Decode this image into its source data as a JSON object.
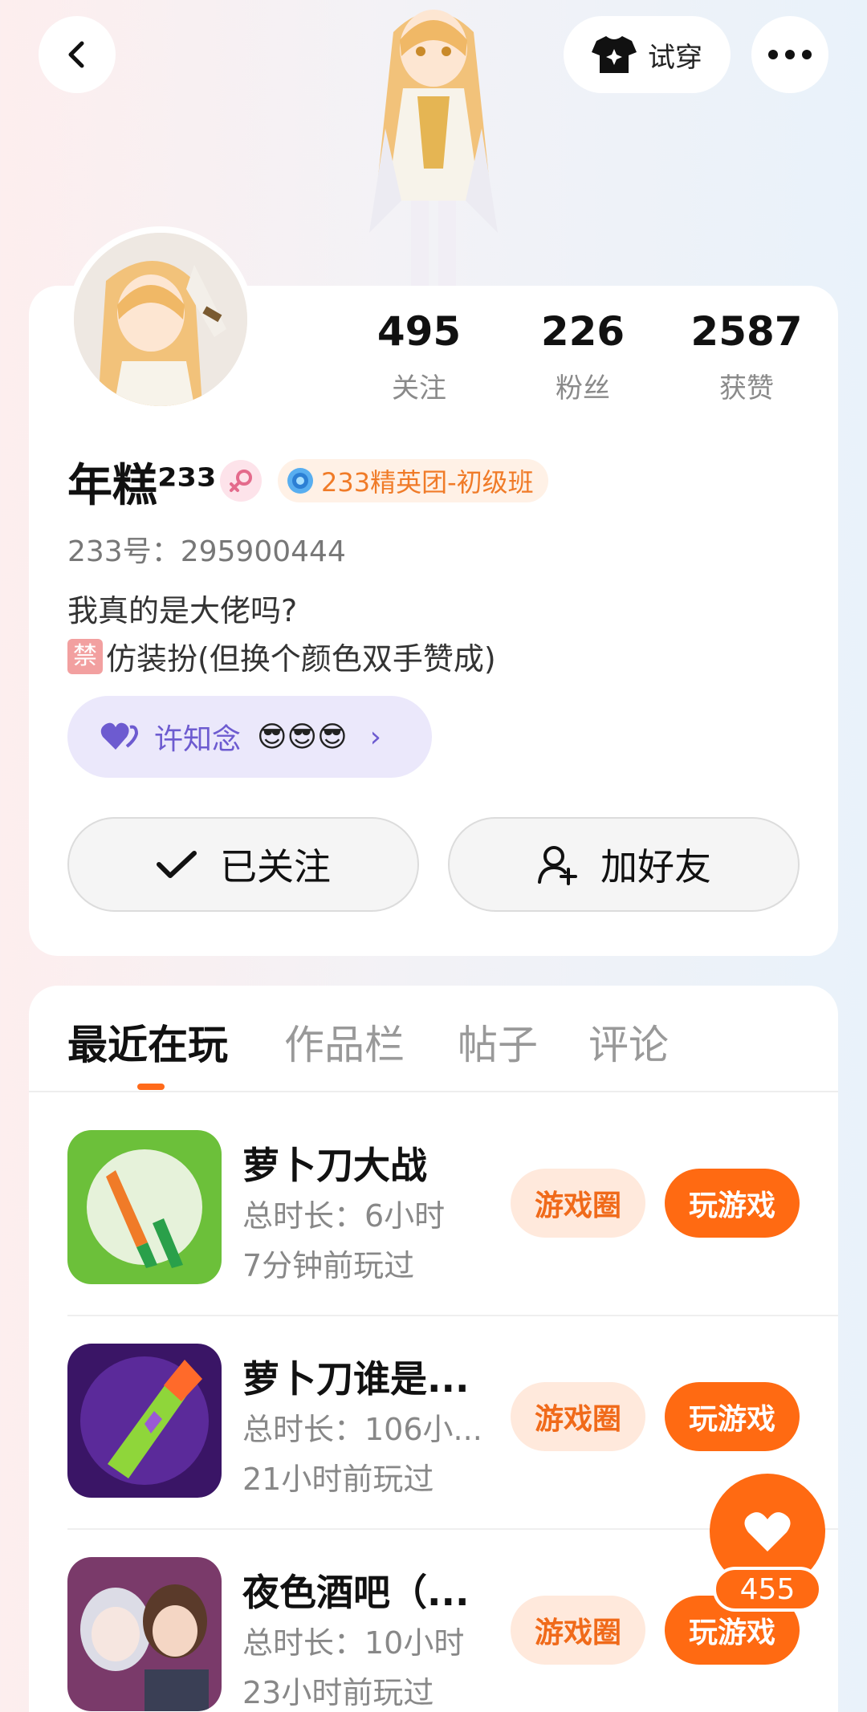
{
  "header": {
    "try_on_label": "试穿"
  },
  "stats": {
    "follow_count": "495",
    "follow_label": "关注",
    "fans_count": "226",
    "fans_label": "粉丝",
    "likes_count": "2587",
    "likes_label": "获赞"
  },
  "profile": {
    "nickname": "年糕²³³",
    "elite_badge": "233精英团-初级班",
    "uid": "233号：295900444",
    "bio_line1": "我真的是大佬吗?",
    "ban_tag": "禁",
    "bio_line2": "仿装扮(但换个颜色双手赞成)",
    "cp_name": "许知念",
    "cp_emojis": "😎😎😎"
  },
  "actions": {
    "followed_label": "已关注",
    "add_friend_label": "加好友"
  },
  "tabs": [
    {
      "label": "最近在玩",
      "active": true
    },
    {
      "label": "作品栏",
      "active": false
    },
    {
      "label": "帖子",
      "active": false
    },
    {
      "label": "评论",
      "active": false
    }
  ],
  "games": [
    {
      "title": "萝卜刀大战",
      "duration": "总时长：6小时",
      "last_played": "7分钟前玩过",
      "circle_label": "游戏圈",
      "play_label": "玩游戏"
    },
    {
      "title": "萝卜刀谁是...",
      "duration": "总时长：106小...",
      "last_played": "21小时前玩过",
      "circle_label": "游戏圈",
      "play_label": "玩游戏"
    },
    {
      "title": "夜色酒吧（...",
      "duration": "总时长：10小时",
      "last_played": "23小时前玩过",
      "circle_label": "游戏圈",
      "play_label": "玩游戏"
    }
  ],
  "favorite": {
    "count": "455"
  },
  "colors": {
    "accent": "#ff6a12",
    "cp_purple": "#6d5bd0",
    "elite_orange": "#f07b28"
  }
}
